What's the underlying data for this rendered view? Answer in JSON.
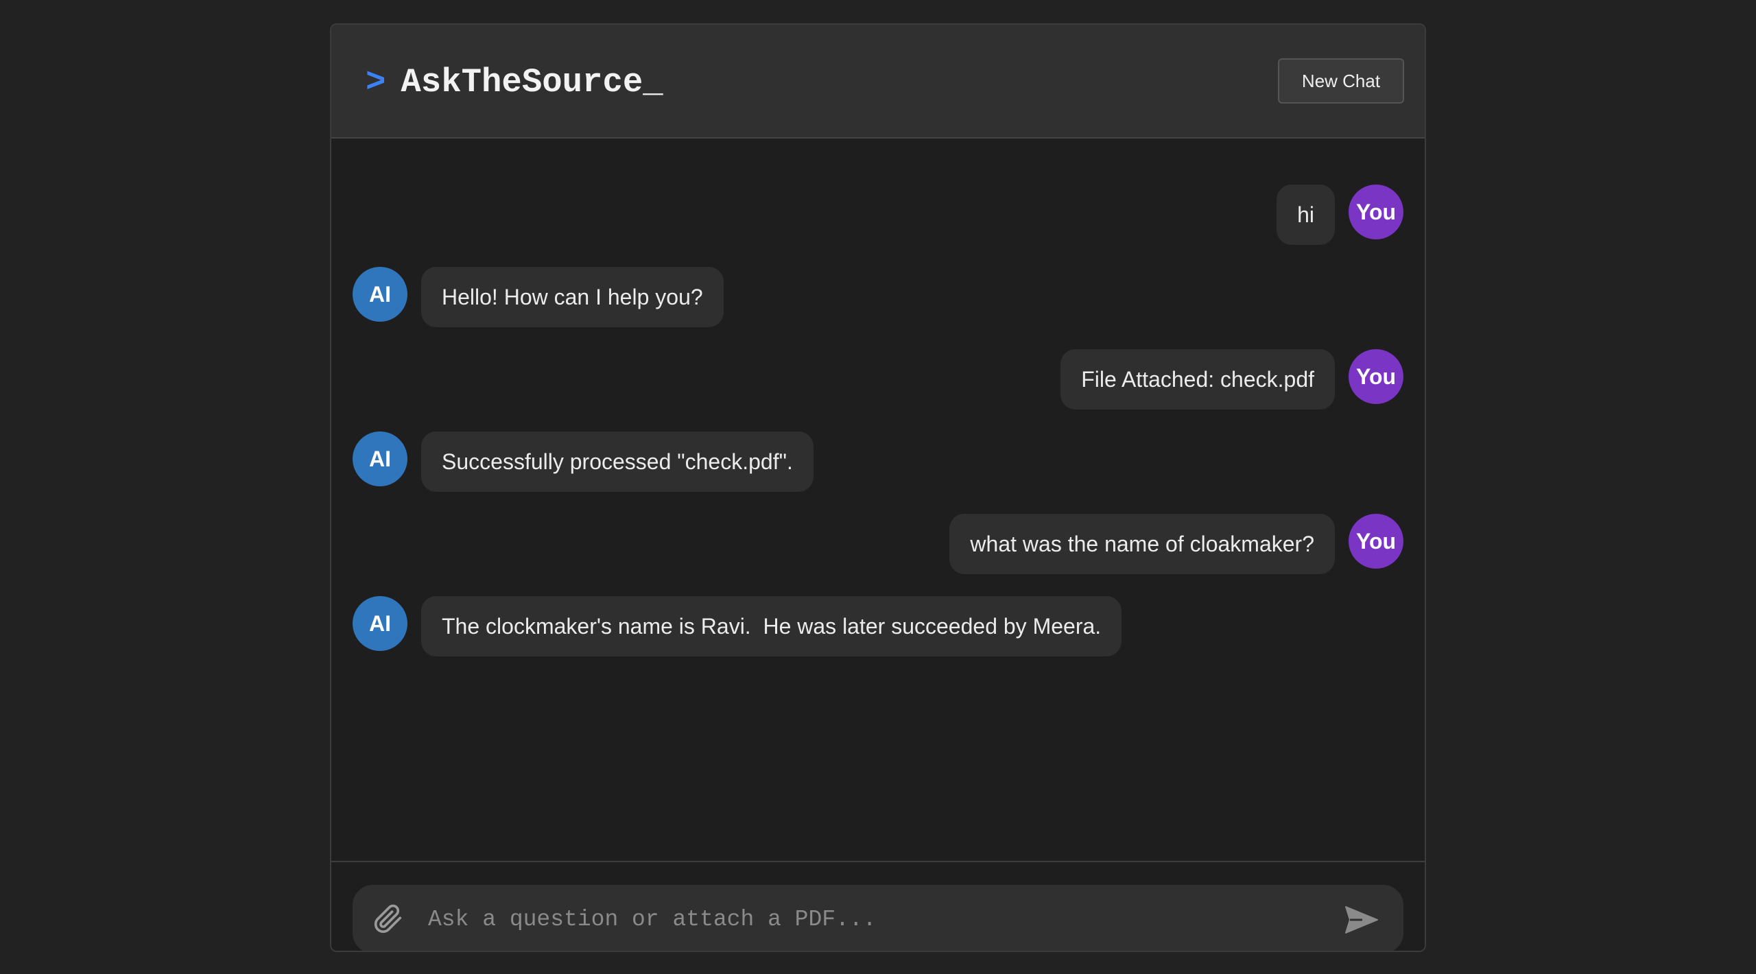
{
  "header": {
    "prompt_symbol": ">",
    "app_name": "AskTheSource",
    "cursor": "_",
    "new_chat_label": "New Chat"
  },
  "messages": [
    {
      "role": "user",
      "avatar": "You",
      "text": "hi"
    },
    {
      "role": "ai",
      "avatar": "AI",
      "text": "Hello! How can I help you?"
    },
    {
      "role": "user",
      "avatar": "You",
      "text": "File Attached: check.pdf"
    },
    {
      "role": "ai",
      "avatar": "AI",
      "text": "Successfully processed \"check.pdf\"."
    },
    {
      "role": "user",
      "avatar": "You",
      "text": "what was the name of cloakmaker?"
    },
    {
      "role": "ai",
      "avatar": "AI",
      "text": "The clockmaker's name is Ravi.  He was later succeeded by Meera."
    }
  ],
  "composer": {
    "placeholder": "Ask a question or attach a PDF...",
    "value": "",
    "attach_icon": "paperclip-icon",
    "send_icon": "send-icon"
  },
  "colors": {
    "page_bg": "#222222",
    "panel_bg": "#1e1e1e",
    "header_bg": "#303030",
    "bubble_bg": "#2f2f2f",
    "user_avatar": "#7a35c4",
    "ai_avatar": "#2f76bd",
    "accent": "#3b82f6"
  }
}
